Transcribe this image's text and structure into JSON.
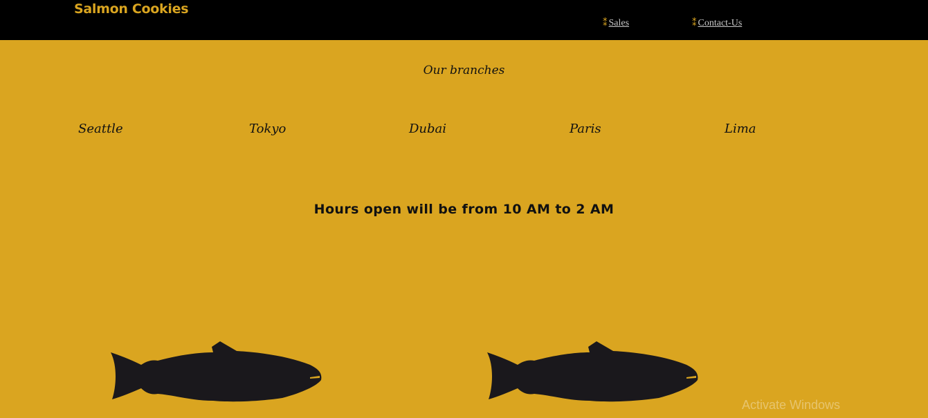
{
  "header": {
    "logo": "Salmon Cookies",
    "nav": [
      {
        "bullet": "⁑",
        "label": "Sales"
      },
      {
        "bullet": "⁑",
        "label": "Contact-Us"
      }
    ]
  },
  "main": {
    "branches_heading": "Our branches",
    "branches": [
      "Seattle",
      "Tokyo",
      "Dubai",
      "Paris",
      "Lima"
    ],
    "hours": "Hours open will be from 10 AM to 2 AM"
  },
  "images": [
    {
      "icon": "salmon-fish-icon"
    },
    {
      "icon": "salmon-fish-icon"
    }
  ],
  "overlay": {
    "watermark": "Activate Windows"
  },
  "colors": {
    "background": "#daa520",
    "header": "#000000",
    "logo": "#daa520",
    "fish": "#1a181c"
  }
}
